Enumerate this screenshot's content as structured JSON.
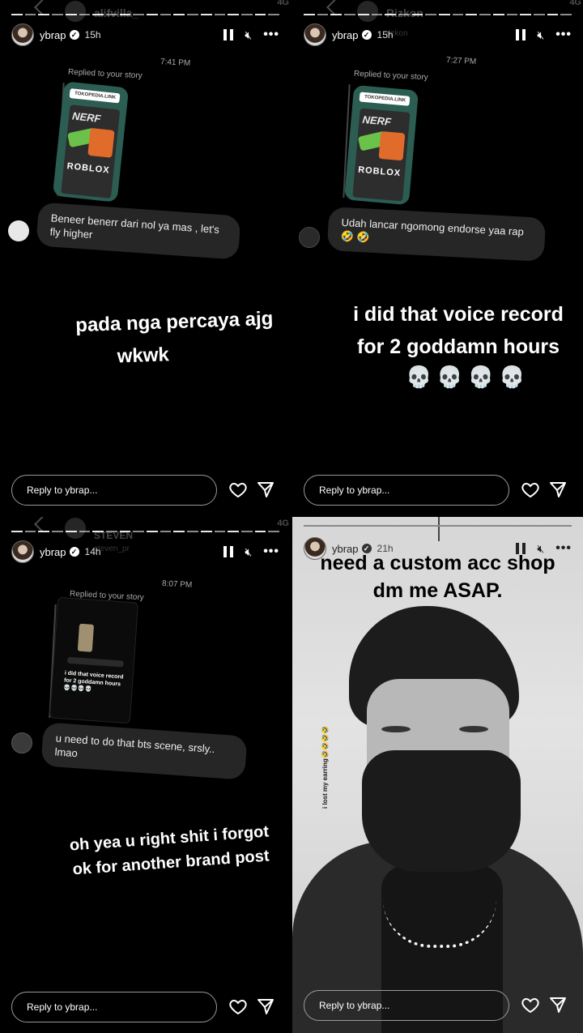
{
  "story": {
    "username": "ybrap",
    "reply_placeholder": "Reply to ybrap..."
  },
  "panels": [
    {
      "ghost_name": "alifvilla_",
      "ghost_sub": "",
      "signal": "4G",
      "time": "15h",
      "message_time": "7:41 PM",
      "replied_label": "Replied to your story",
      "thumb_strip": "TOKOPEDIA.LINK",
      "thumb_brand": "NERF",
      "thumb_sub": "ROBLOX",
      "reply_text": "Beneer benerr dari nol ya mas , let's fly higher",
      "caption_lines": [
        "pada nga percaya ajg",
        "wkwk"
      ]
    },
    {
      "ghost_name": "Rizkon",
      "ghost_sub": "rizkon",
      "signal": "4G",
      "time": "15h",
      "message_time": "7:27 PM",
      "replied_label": "Replied to your story",
      "thumb_strip": "TOKOPEDIA.LINK",
      "thumb_brand": "NERF",
      "thumb_sub": "ROBLOX",
      "reply_text": "Udah lancar ngomong endorse yaa rap🤣 🤣",
      "caption_lines": [
        "i did that voice record",
        "for 2 goddamn hours"
      ],
      "emoji": "💀💀💀💀"
    },
    {
      "ghost_name": "STEVEN",
      "ghost_sub": "steven_pr",
      "signal": "4G",
      "time": "14h",
      "message_time": "8:07 PM",
      "replied_label": "Replied to your story",
      "mini_text": "i did that voice record for 2 goddamn hours 💀💀💀💀",
      "reply_text": "u need to do that bts scene, srsly.. lmao",
      "caption_lines": [
        "oh yea u right shit i forgot",
        "ok for another brand post"
      ]
    },
    {
      "time": "21h",
      "caption_lines": [
        "need a custom acc shop",
        "dm me ASAP."
      ],
      "side_text": "i lost my earring🤣🤣🤣🤣"
    }
  ],
  "icons": {
    "pause": "pause-icon",
    "mute": "mute-icon",
    "more": "more-icon",
    "heart": "heart-icon",
    "send": "send-icon",
    "verified": "verified-icon"
  },
  "colors": {
    "background": "#000000",
    "bubble": "#262626",
    "reply_border": "#999999"
  }
}
